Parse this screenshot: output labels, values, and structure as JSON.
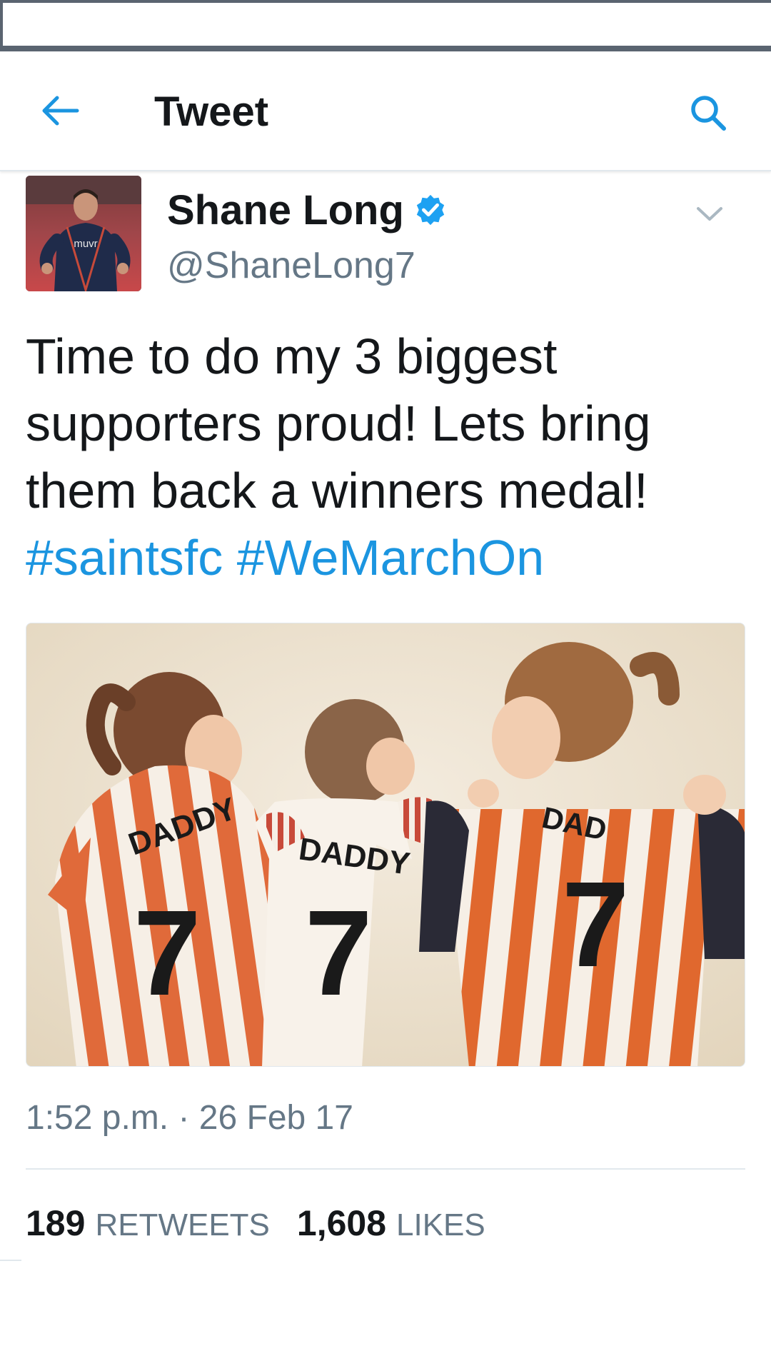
{
  "header": {
    "title": "Tweet",
    "back_icon": "arrow-left-icon",
    "search_icon": "search-icon",
    "accent_color": "#1b95e0"
  },
  "tweet": {
    "author": {
      "name": "Shane Long",
      "handle": "@ShaneLong7",
      "verified": true
    },
    "text_lines": [
      "Time to do my 3 biggest",
      "supporters proud! Lets bring",
      "them back a winners medal!"
    ],
    "hashtags": [
      "#saintsfc",
      "#WeMarchOn"
    ],
    "media": {
      "jerseys": [
        {
          "name": "DADDY",
          "number": "7"
        },
        {
          "name": "DADDY",
          "number": "7"
        },
        {
          "name": "DAD",
          "number": "7"
        }
      ]
    },
    "timestamp": "1:52 p.m. · 26 Feb 17",
    "stats": {
      "retweets_count": "189",
      "retweets_label": "RETWEETS",
      "likes_count": "1,608",
      "likes_label": "LIKES"
    },
    "avatar_sponsor": "muvr"
  }
}
